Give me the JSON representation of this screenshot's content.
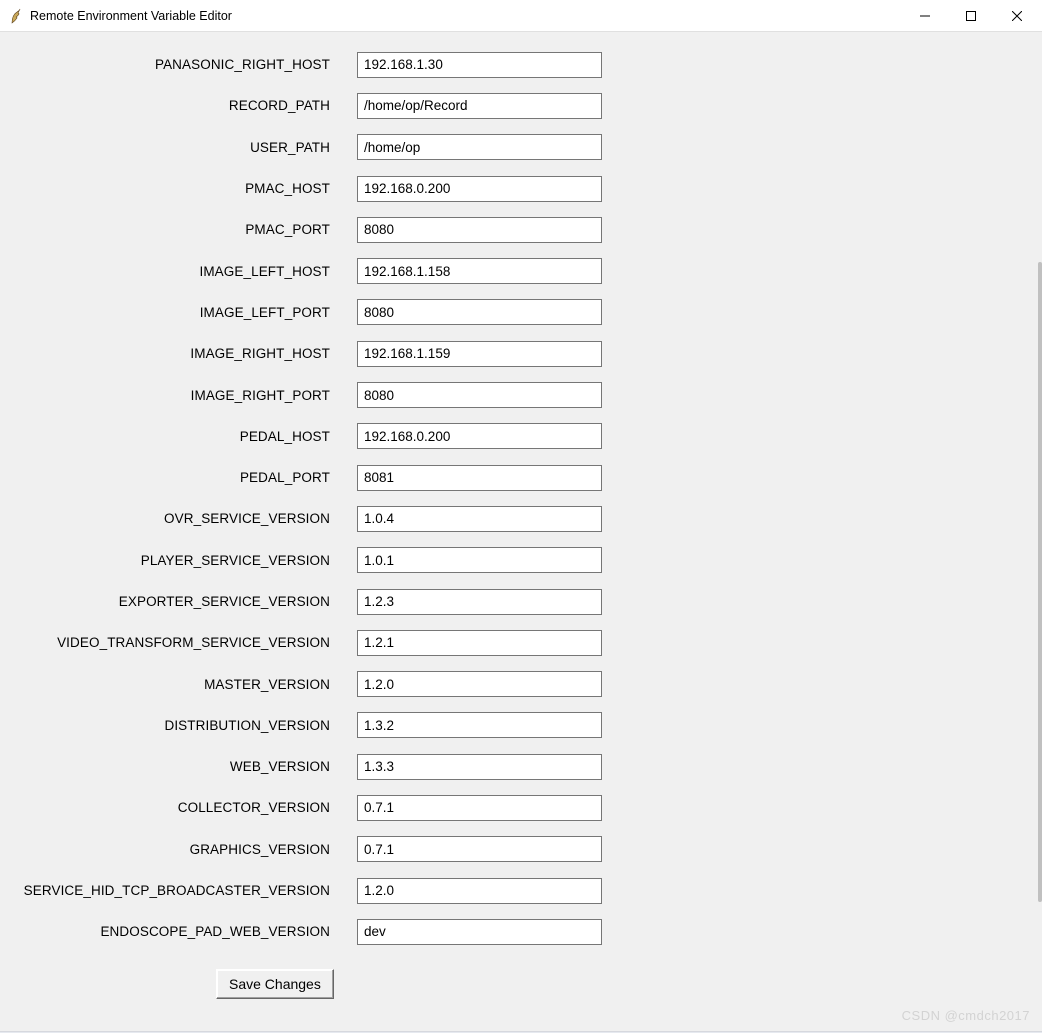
{
  "window": {
    "title": "Remote Environment Variable Editor"
  },
  "fields": [
    {
      "label": "PANASONIC_RIGHT_HOST",
      "value": "192.168.1.30"
    },
    {
      "label": "RECORD_PATH",
      "value": "/home/op/Record"
    },
    {
      "label": "USER_PATH",
      "value": "/home/op"
    },
    {
      "label": "PMAC_HOST",
      "value": "192.168.0.200"
    },
    {
      "label": "PMAC_PORT",
      "value": "8080"
    },
    {
      "label": "IMAGE_LEFT_HOST",
      "value": "192.168.1.158"
    },
    {
      "label": "IMAGE_LEFT_PORT",
      "value": "8080"
    },
    {
      "label": "IMAGE_RIGHT_HOST",
      "value": "192.168.1.159"
    },
    {
      "label": "IMAGE_RIGHT_PORT",
      "value": "8080"
    },
    {
      "label": "PEDAL_HOST",
      "value": "192.168.0.200"
    },
    {
      "label": "PEDAL_PORT",
      "value": "8081"
    },
    {
      "label": "OVR_SERVICE_VERSION",
      "value": "1.0.4"
    },
    {
      "label": "PLAYER_SERVICE_VERSION",
      "value": "1.0.1"
    },
    {
      "label": "EXPORTER_SERVICE_VERSION",
      "value": "1.2.3"
    },
    {
      "label": "VIDEO_TRANSFORM_SERVICE_VERSION",
      "value": "1.2.1"
    },
    {
      "label": "MASTER_VERSION",
      "value": "1.2.0"
    },
    {
      "label": "DISTRIBUTION_VERSION",
      "value": "1.3.2"
    },
    {
      "label": "WEB_VERSION",
      "value": "1.3.3"
    },
    {
      "label": "COLLECTOR_VERSION",
      "value": "0.7.1"
    },
    {
      "label": "GRAPHICS_VERSION",
      "value": "0.7.1"
    },
    {
      "label": "SERVICE_HID_TCP_BROADCASTER_VERSION",
      "value": "1.2.0"
    },
    {
      "label": "ENDOSCOPE_PAD_WEB_VERSION",
      "value": "dev"
    }
  ],
  "buttons": {
    "save_label": "Save Changes"
  },
  "watermark": "CSDN @cmdch2017"
}
